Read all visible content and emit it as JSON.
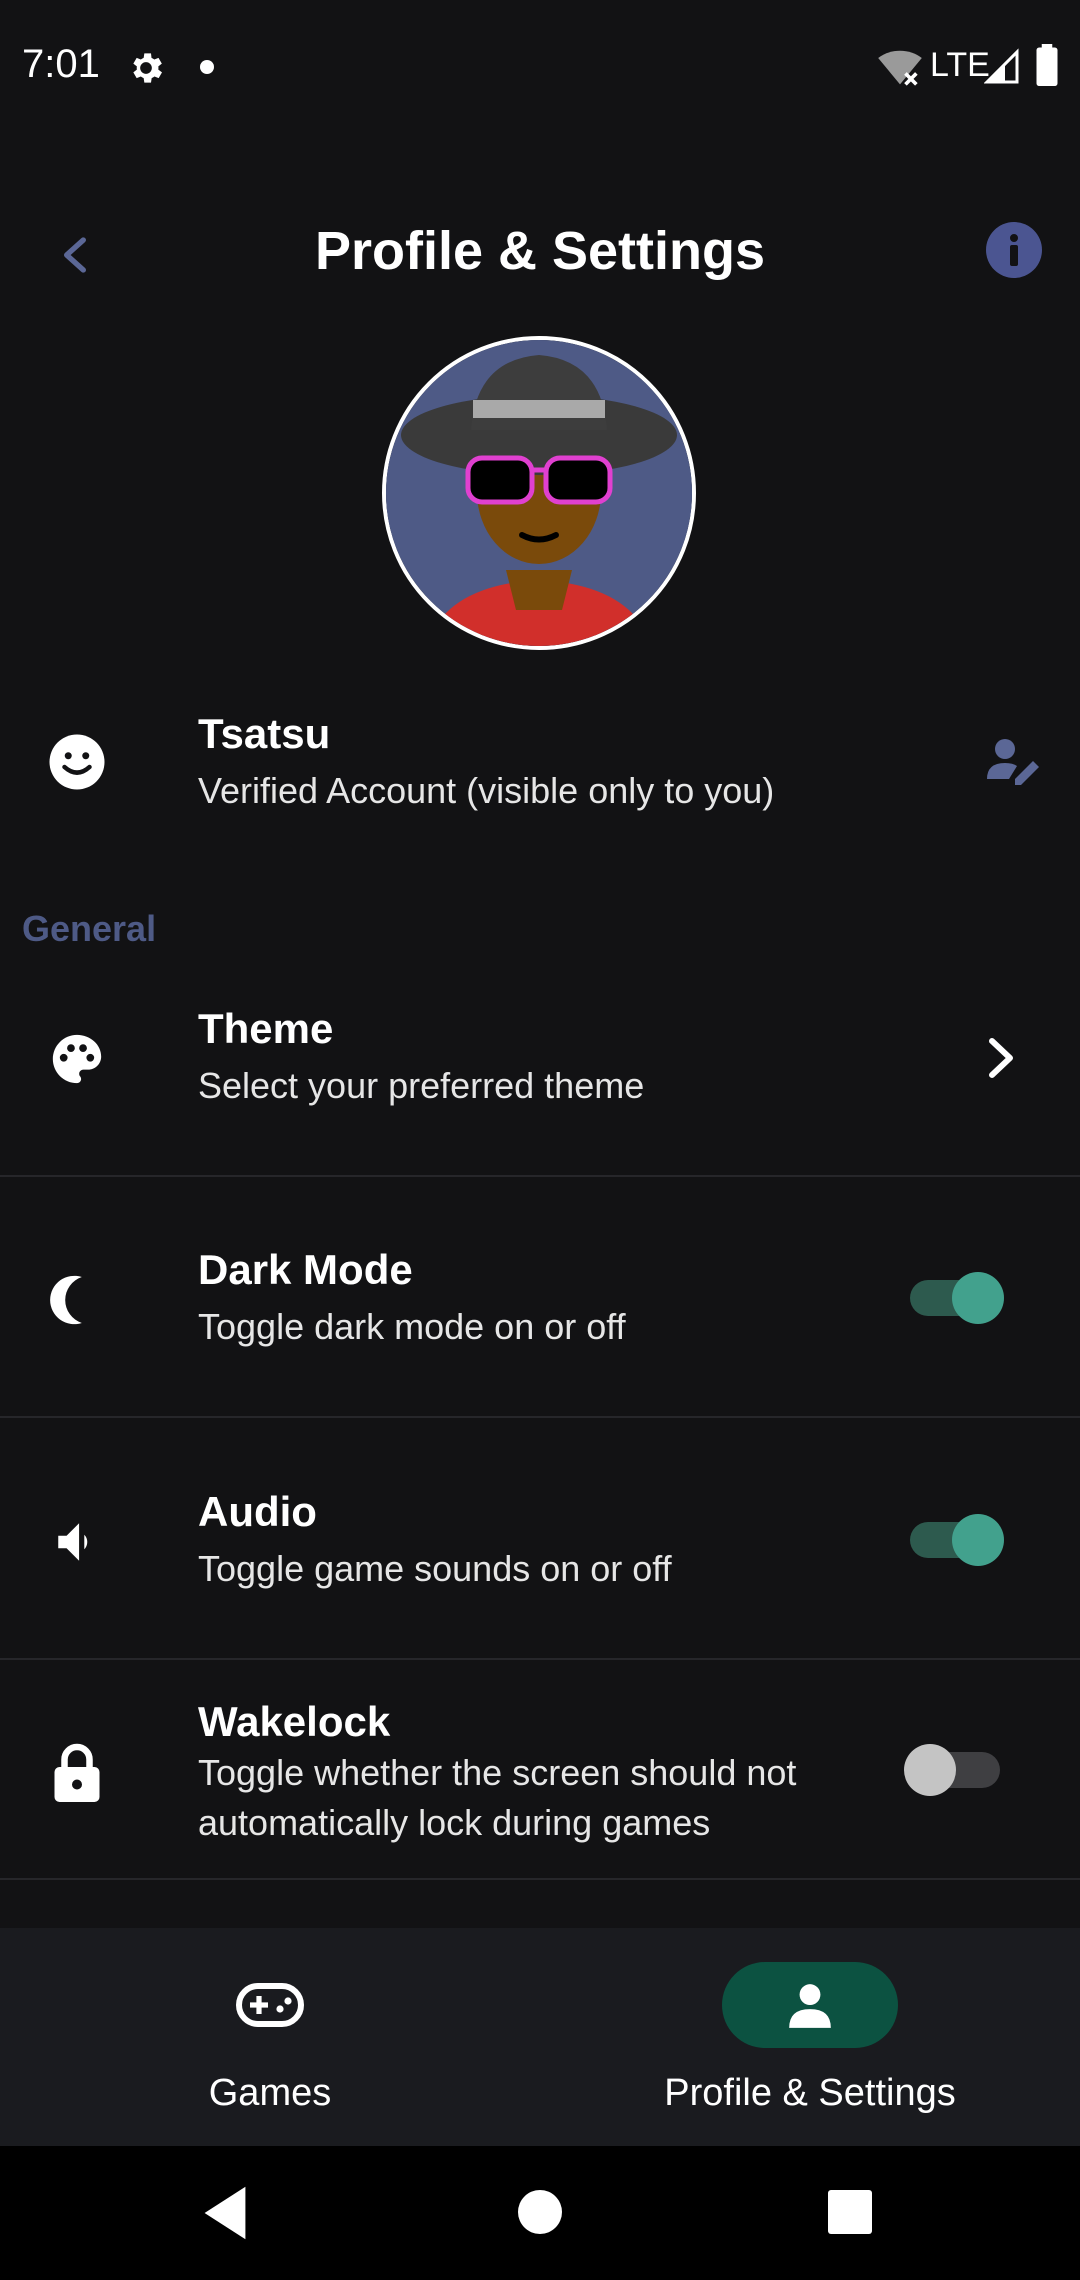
{
  "status_bar": {
    "time": "7:01",
    "network": "LTE"
  },
  "header": {
    "title": "Profile & Settings"
  },
  "profile": {
    "name": "Tsatsu",
    "subtitle": "Verified Account (visible only to you)"
  },
  "section": {
    "general": "General"
  },
  "settings": [
    {
      "title": "Theme",
      "subtitle": "Select your preferred theme"
    },
    {
      "title": "Dark Mode",
      "subtitle": "Toggle dark mode on or off",
      "enabled": true
    },
    {
      "title": "Audio",
      "subtitle": "Toggle game sounds on or off",
      "enabled": true
    },
    {
      "title": "Wakelock",
      "subtitle": "Toggle whether the screen should not automatically lock during games",
      "enabled": false
    }
  ],
  "bottom_nav": {
    "games_label": "Games",
    "profile_label": "Profile & Settings",
    "active": "Profile & Settings"
  },
  "colors": {
    "background": "#121214",
    "accent": "#42a18d",
    "nav_active_pill": "#0c5241",
    "section_label": "#4e5a86",
    "info_badge": "#4b5591"
  }
}
